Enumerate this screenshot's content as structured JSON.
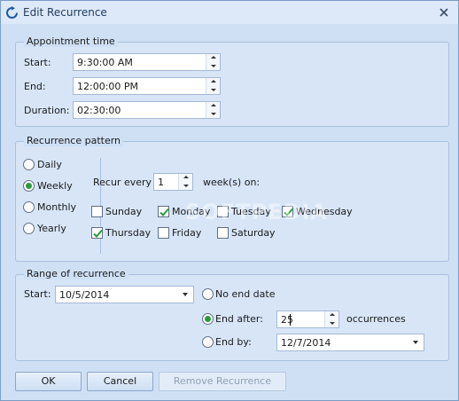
{
  "window": {
    "title": "Edit Recurrence",
    "title_icon": "recurrence-icon",
    "close_icon": "close-icon"
  },
  "appointment": {
    "group_title": "Appointment time",
    "start_label": "Start:",
    "start_value": "9:30:00 AM",
    "end_label": "End:",
    "end_value": "12:00:00 PM",
    "duration_label": "Duration:",
    "duration_value": "02:30:00"
  },
  "pattern": {
    "group_title": "Recurrence pattern",
    "types": [
      {
        "label": "Daily",
        "selected": false
      },
      {
        "label": "Weekly",
        "selected": true
      },
      {
        "label": "Monthly",
        "selected": false
      },
      {
        "label": "Yearly",
        "selected": false
      }
    ],
    "recur_every_label": "Recur every",
    "recur_every_value": "1",
    "weeks_on_label": "week(s) on:",
    "days": [
      {
        "label": "Sunday",
        "checked": false
      },
      {
        "label": "Monday",
        "checked": true
      },
      {
        "label": "Tuesday",
        "checked": false
      },
      {
        "label": "Wednesday",
        "checked": true
      },
      {
        "label": "Thursday",
        "checked": true
      },
      {
        "label": "Friday",
        "checked": false
      },
      {
        "label": "Saturday",
        "checked": false
      }
    ]
  },
  "range": {
    "group_title": "Range of recurrence",
    "start_label": "Start:",
    "start_value": "10/5/2014",
    "no_end_label": "No end date",
    "end_after_label": "End after:",
    "end_after_value": "25",
    "occurrences_label": "occurrences",
    "end_by_label": "End by:",
    "end_by_value": "12/7/2014",
    "selected_option": "end_after"
  },
  "buttons": {
    "ok": "OK",
    "cancel": "Cancel",
    "remove": "Remove Recurrence"
  },
  "watermark": "SOFTPEDIA",
  "colors": {
    "background": "#cfe0f5",
    "accent_check": "#2a9a3a",
    "border": "#a9c0dd"
  }
}
